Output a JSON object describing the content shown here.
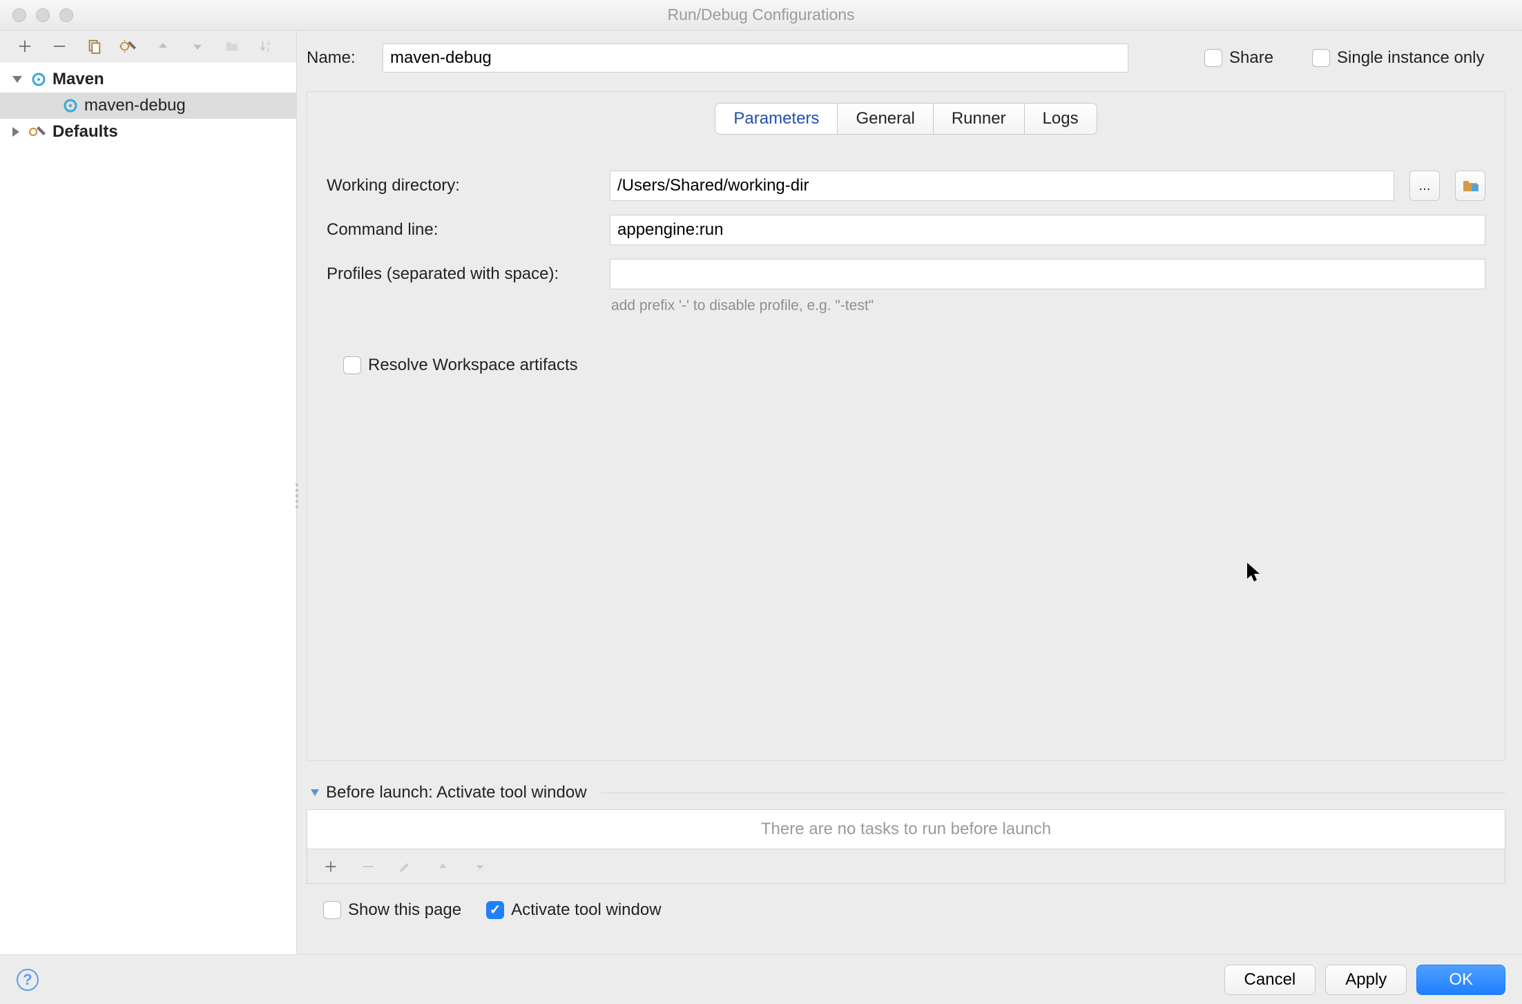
{
  "window": {
    "title": "Run/Debug Configurations"
  },
  "name_row": {
    "label": "Name:",
    "value": "maven-debug",
    "share_label": "Share",
    "single_instance_label": "Single instance only"
  },
  "tree": {
    "root_label": "Maven",
    "child_label": "maven-debug",
    "defaults_label": "Defaults"
  },
  "tabs": [
    "Parameters",
    "General",
    "Runner",
    "Logs"
  ],
  "params": {
    "working_dir_label": "Working directory:",
    "working_dir_value": "/Users/Shared/working-dir",
    "command_line_label": "Command line:",
    "command_line_value": "appengine:run",
    "profiles_label": "Profiles (separated with space):",
    "profiles_hint": "add prefix '-' to disable profile, e.g. \"-test\"",
    "resolve_label": "Resolve Workspace artifacts"
  },
  "before_launch": {
    "header": "Before launch: Activate tool window",
    "empty_text": "There are no tasks to run before launch",
    "show_page_label": "Show this page",
    "activate_label": "Activate tool window"
  },
  "footer": {
    "cancel": "Cancel",
    "apply": "Apply",
    "ok": "OK"
  }
}
